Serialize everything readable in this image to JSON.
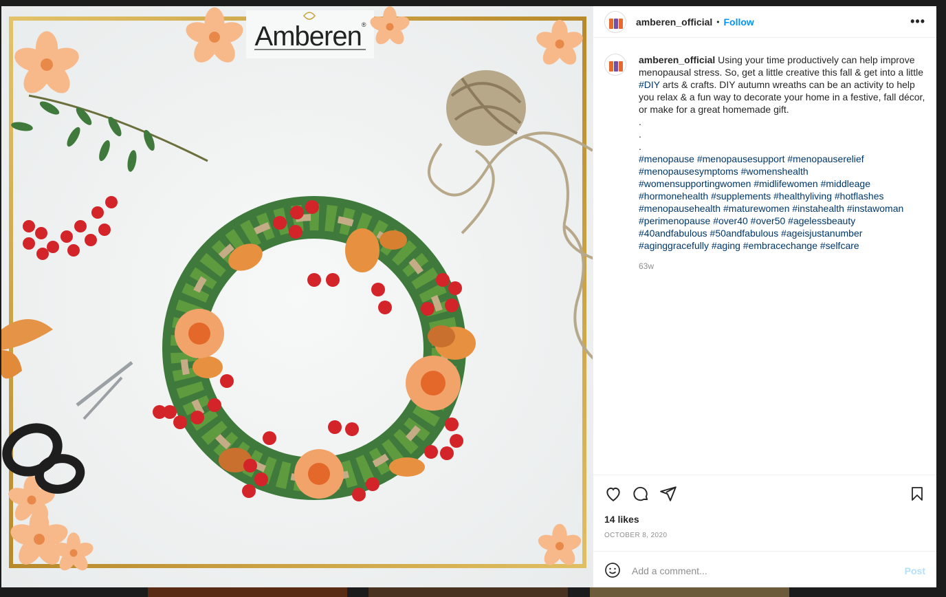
{
  "post": {
    "username": "amberen_official",
    "separator": "•",
    "follow_label": "Follow",
    "more_label": "•••",
    "brand_logo_text": "Amberen",
    "brand_logo_mark": "®",
    "caption_user": "amberen_official",
    "caption_part1": " Using your time productively can help improve menopausal stress. So, get a little creative this fall & get into a little ",
    "caption_tag": "#DIY",
    "caption_part2": " arts & crafts. DIY autumn wreaths can be an activity to help you relax & a fun way to decorate your home in a festive, fall décor, or make for a great homemade gift.",
    "caption_dots": [
      ".",
      ".",
      "."
    ],
    "hashtags": [
      "#menopause",
      "#menopausesupport",
      "#menopauserelief",
      "#menopausesymptoms",
      "#womenshealth",
      "#womensupportingwomen",
      "#midlifewomen",
      "#middleage",
      "#hormonehealth",
      "#supplements",
      "#healthyliving",
      "#hotflashes",
      "#menopausehealth",
      "#maturewomen",
      "#instahealth",
      "#instawoman",
      "#perimenopause",
      "#over40",
      "#over50",
      "#agelessbeauty",
      "#40andfabulous",
      "#50andfabulous",
      "#ageisjustanumber",
      "#aginggracefully",
      "#aging",
      "#embracechange",
      "#selfcare"
    ],
    "time_ago": "63w",
    "likes": "14 likes",
    "date": "OCTOBER 8, 2020"
  },
  "icons": {
    "like": "heart-icon",
    "comment": "comment-icon",
    "share": "paper-plane-icon",
    "save": "bookmark-icon",
    "emoji": "emoji-smile-icon",
    "more": "more-horizontal-icon"
  },
  "comment_box": {
    "placeholder": "Add a comment...",
    "post_label": "Post"
  },
  "colors": {
    "link": "#0095f6",
    "hashtag": "#00376b",
    "muted": "#8e8e8e",
    "post_disabled": "#b2dffc",
    "frame_gold": "#c9a13b"
  }
}
